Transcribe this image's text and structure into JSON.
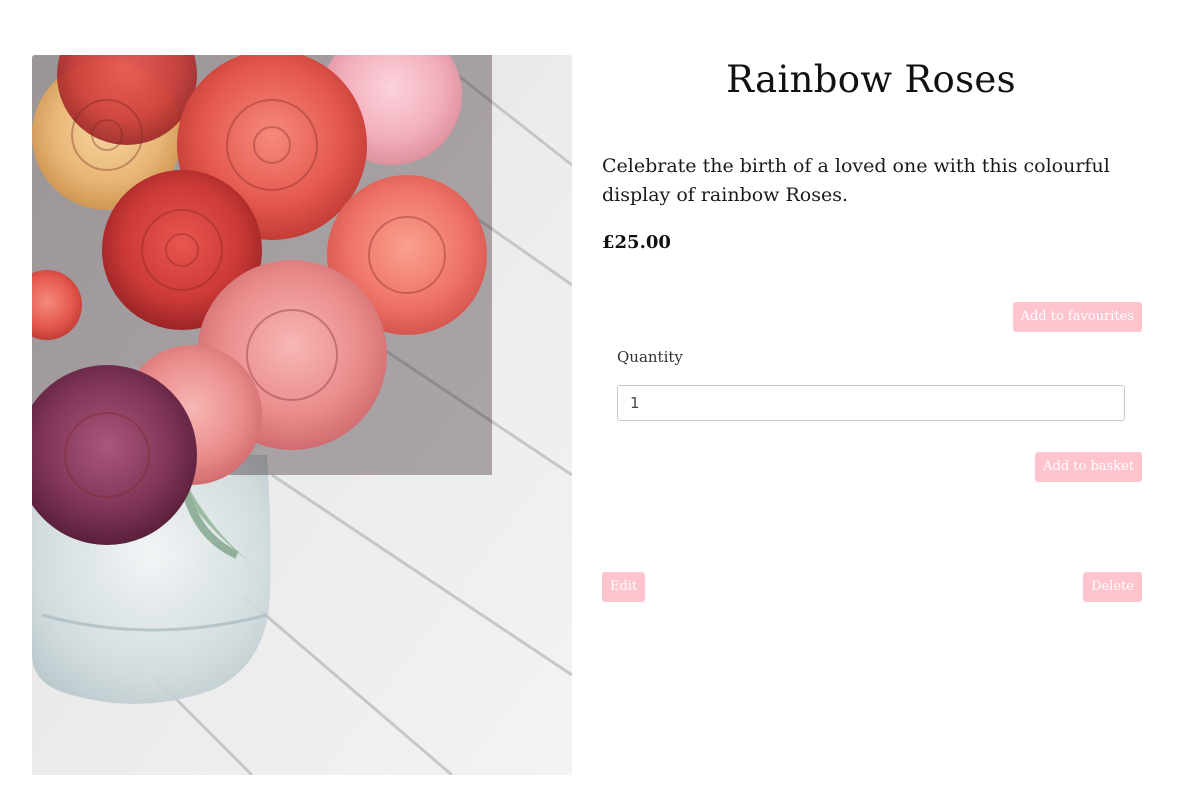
{
  "product": {
    "title": "Rainbow Roses",
    "description": "Celebrate the birth of a loved one with this colourful display of rainbow Roses.",
    "price": "£25.00"
  },
  "actions": {
    "favourites_label": "Add to favourites",
    "quantity_label": "Quantity",
    "quantity_value": "1",
    "basket_label": "Add to basket",
    "edit_label": "Edit",
    "delete_label": "Delete"
  },
  "colors": {
    "button_bg": "#ffc4ce",
    "button_text": "#ffffff"
  }
}
